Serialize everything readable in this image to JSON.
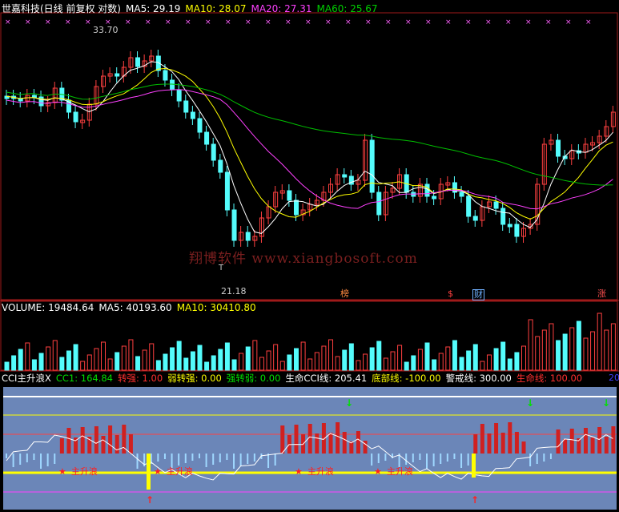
{
  "colors": {
    "up": "#ff4040",
    "down": "#54fcfc",
    "ma5": "#ffffff",
    "ma10": "#ffff00",
    "ma20": "#ff40ff",
    "ma60": "#00c000",
    "panelBlue": "#6b86b8",
    "frame": "#a01a1a"
  },
  "price_header": {
    "title": "世嘉科技(日线 前复权 对数)",
    "ma5": "MA5: 29.19",
    "ma10": "MA10: 28.07",
    "ma20": "MA20: 27.31",
    "ma60": "MA60: 25.67"
  },
  "price_labels": {
    "high": "33.70",
    "low": "21.18",
    "t_mark": "T"
  },
  "watermark": "翔博软件 www.xiangbosoft.com",
  "badges": [
    {
      "text": "榜",
      "color": "#ff8a40"
    },
    {
      "text": "$",
      "color": "#ff4040"
    },
    {
      "text": "财",
      "color": "#6fb0ff"
    },
    {
      "text": "涨",
      "color": "#ff5050"
    }
  ],
  "volume_header": {
    "volume": "VOLUME: 19484.64",
    "ma5": "MA5: 40193.60",
    "ma10": "MA10: 30410.80"
  },
  "cci_header": {
    "name": "CCI主升浪X",
    "cc1": "CC1: 164.84",
    "zhuanqiang": "转强: 1.00",
    "ruozhuanqiang": "弱转强: 0.00",
    "qiangzhuanruo": "强转弱: 0.00",
    "shengming_cci": "生命CCI线: 205.41",
    "dibu": "底部线: -100.00",
    "jingjie": "警戒线: 300.00",
    "shengming": "生命线: 100.00",
    "corner": "20"
  },
  "cci_markers": {
    "star_label": "主升浪",
    "down_arrow": "↓",
    "up_arrow": "↑"
  },
  "chart_data": {
    "type": "candlestick",
    "panels": [
      "price",
      "volume",
      "cci"
    ],
    "price_axis": "log",
    "price_range": [
      21.18,
      33.7
    ]
  }
}
